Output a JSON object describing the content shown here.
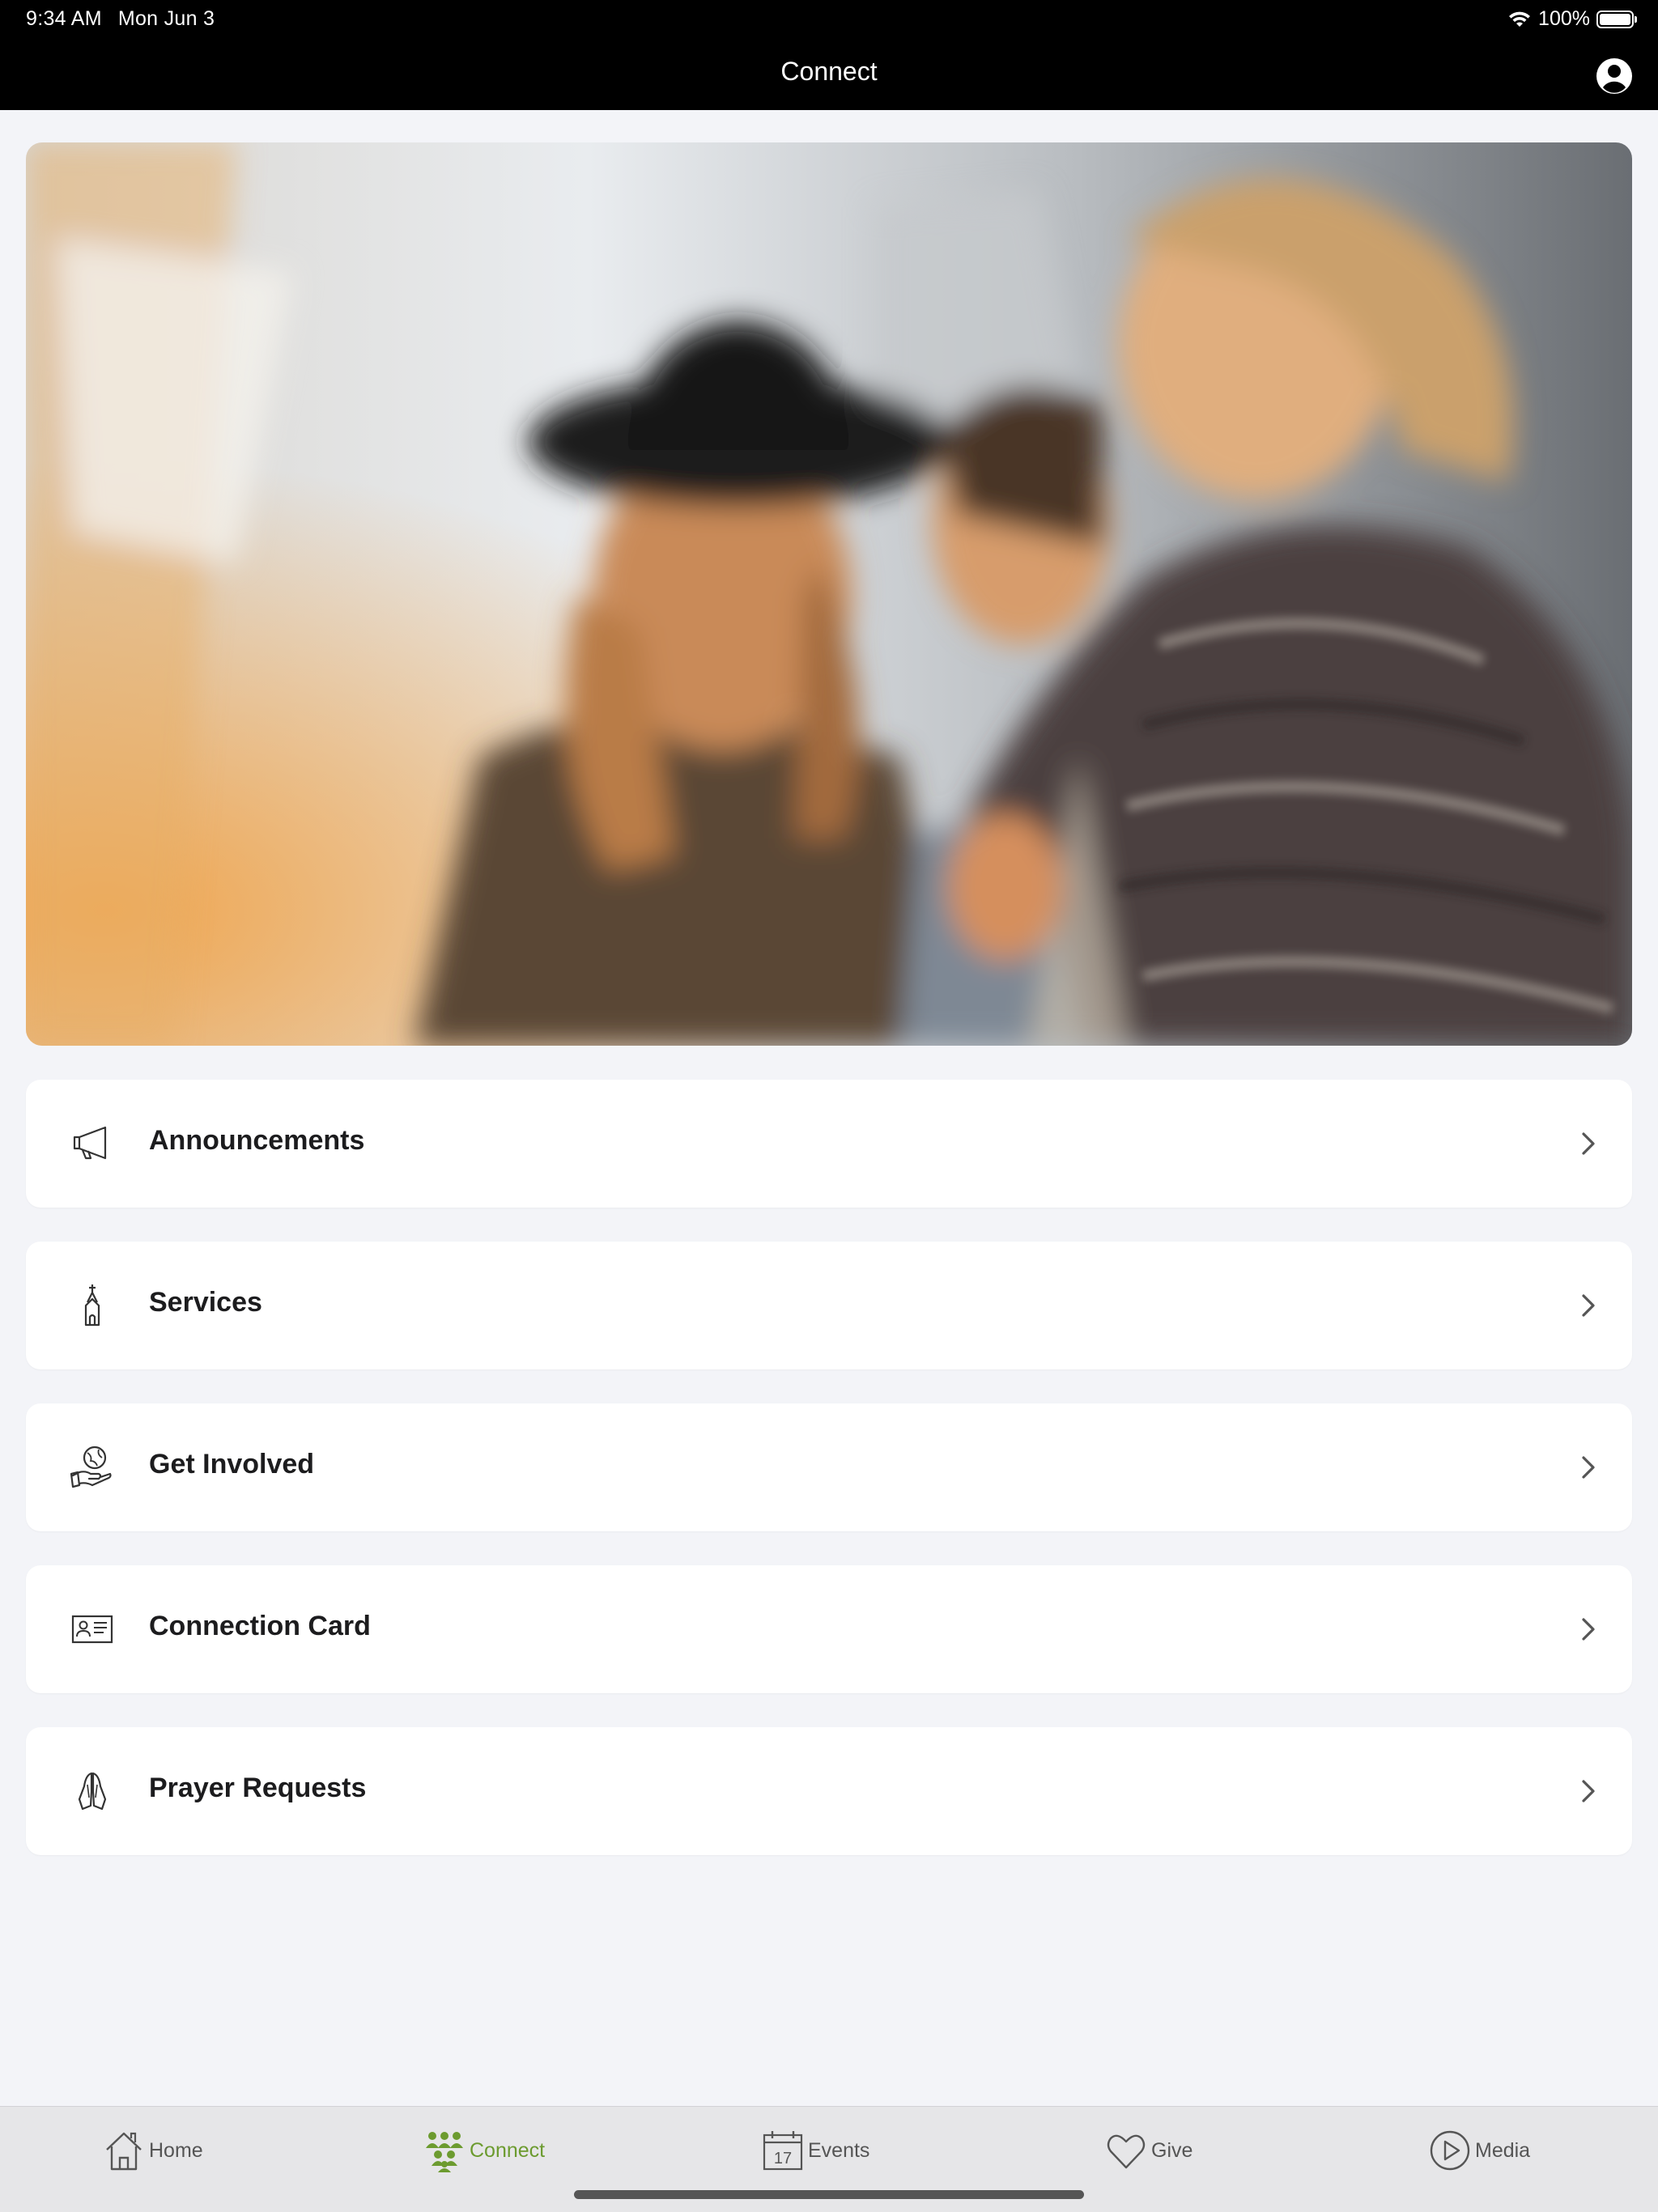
{
  "status_bar": {
    "time": "9:34 AM",
    "date": "Mon Jun 3",
    "battery": "100%",
    "battery_level": 1.0
  },
  "nav": {
    "title": "Connect",
    "profile_icon": "person-circle-icon"
  },
  "hero": {
    "description_icon": "group-photo"
  },
  "menu": [
    {
      "label": "Announcements",
      "icon": "megaphone-icon"
    },
    {
      "label": "Services",
      "icon": "church-icon"
    },
    {
      "label": "Get Involved",
      "icon": "hand-globe-icon"
    },
    {
      "label": "Connection Card",
      "icon": "id-card-icon"
    },
    {
      "label": "Prayer Requests",
      "icon": "praying-hands-icon"
    }
  ],
  "tabs": [
    {
      "label": "Home",
      "icon": "house-icon"
    },
    {
      "label": "Connect",
      "icon": "people-icon",
      "active": true
    },
    {
      "label": "Events",
      "icon": "calendar-icon",
      "calendar_day": "17"
    },
    {
      "label": "Give",
      "icon": "heart-icon"
    },
    {
      "label": "Media",
      "icon": "play-circle-icon"
    }
  ],
  "colors": {
    "accent": "#6c9b2f",
    "bar": "#000000",
    "background": "#f3f4f8"
  }
}
